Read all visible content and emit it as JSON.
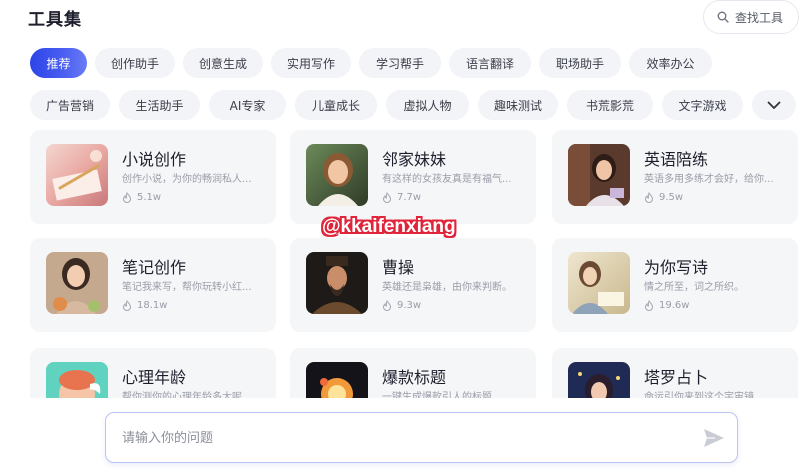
{
  "header": {
    "title": "工具集",
    "search_label": "查找工具"
  },
  "categories_row1": [
    {
      "label": "推荐",
      "active": true
    },
    {
      "label": "创作助手",
      "active": false
    },
    {
      "label": "创意生成",
      "active": false
    },
    {
      "label": "实用写作",
      "active": false
    },
    {
      "label": "学习帮手",
      "active": false
    },
    {
      "label": "语言翻译",
      "active": false
    },
    {
      "label": "职场助手",
      "active": false
    },
    {
      "label": "效率办公",
      "active": false
    }
  ],
  "categories_row2": [
    {
      "label": "广告营销"
    },
    {
      "label": "生活助手"
    },
    {
      "label": "AI专家"
    },
    {
      "label": "儿童成长"
    },
    {
      "label": "虚拟人物"
    },
    {
      "label": "趣味测试"
    },
    {
      "label": "书荒影荒"
    },
    {
      "label": "文字游戏"
    }
  ],
  "cards": [
    {
      "name": "小说创作",
      "desc": "创作小说，为你的畅润私人...",
      "count": "5.1w"
    },
    {
      "name": "邻家妹妹",
      "desc": "有这样的女孩友真是有福气...",
      "count": "7.7w"
    },
    {
      "name": "英语陪练",
      "desc": "英语多用多练才会好，给你...",
      "count": "9.5w"
    },
    {
      "name": "笔记创作",
      "desc": "笔记我来写，帮你玩转小红...",
      "count": "18.1w"
    },
    {
      "name": "曹操",
      "desc": "英雄还是枭雄，由你来判断。",
      "count": "9.3w"
    },
    {
      "name": "为你写诗",
      "desc": "情之所至，词之所织。",
      "count": "19.6w"
    },
    {
      "name": "心理年龄",
      "desc": "帮你测你的心理年龄多大呢",
      "count": ""
    },
    {
      "name": "爆款标题",
      "desc": "一键生成爆款引人的标题",
      "count": ""
    },
    {
      "name": "塔罗占卜",
      "desc": "命运引你来到这个宇宙镜",
      "count": ""
    }
  ],
  "watermark": "@kkaifenxiang",
  "chat_input": {
    "placeholder": "请输入你的问题"
  },
  "icons": {
    "search": "search-icon",
    "expand": "chevron-down-icon",
    "fire": "fire-icon",
    "send": "send-icon"
  }
}
